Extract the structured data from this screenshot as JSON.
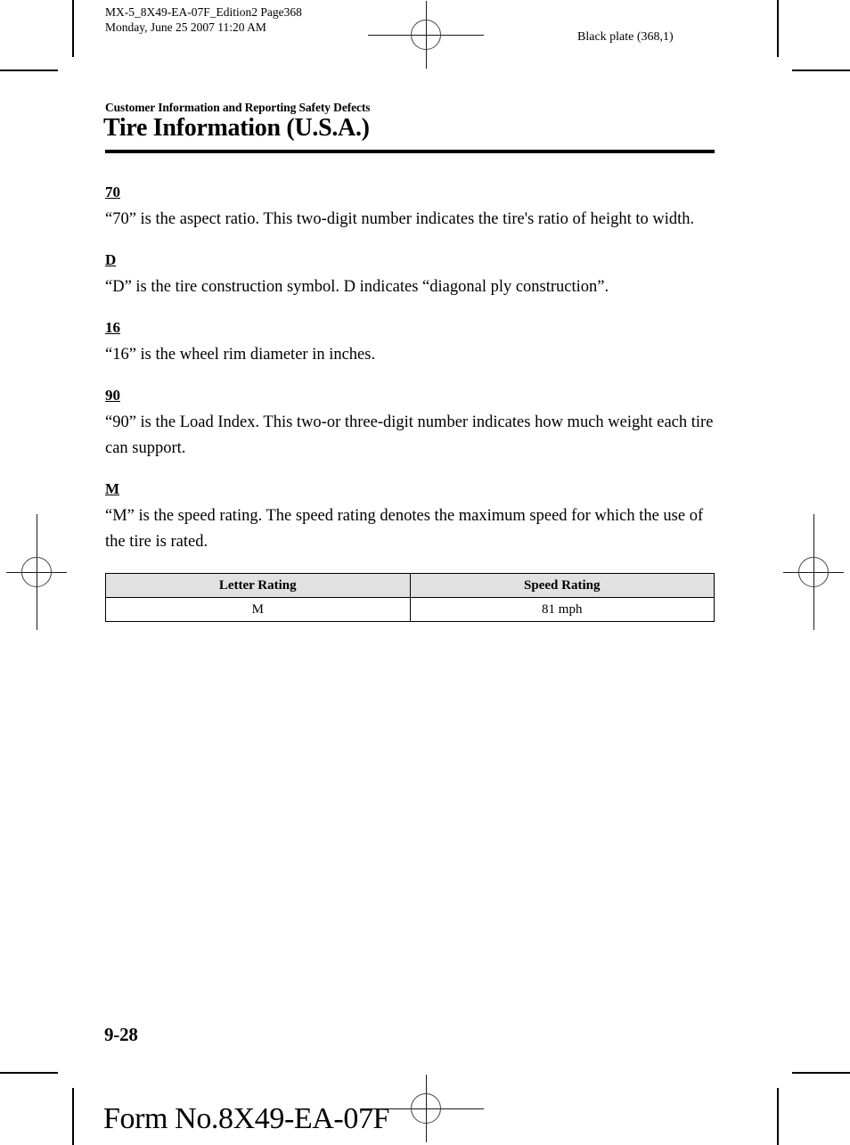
{
  "slug": {
    "line1": "MX-5_8X49-EA-07F_Edition2 Page368",
    "line2": "Monday, June 25 2007 11:20 AM",
    "black_plate": "Black plate (368,1)"
  },
  "header": {
    "kicker": "Customer Information and Reporting Safety Defects",
    "title": "Tire Information (U.S.A.)"
  },
  "sections": [
    {
      "term": "70",
      "body": "“70” is the aspect ratio. This two-digit number indicates the tire's ratio of height to width."
    },
    {
      "term": "D",
      "body": "“D” is the tire construction symbol. D indicates “diagonal ply construction”."
    },
    {
      "term": "16",
      "body": "“16” is the wheel rim diameter in inches."
    },
    {
      "term": "90",
      "body": "“90” is the Load Index. This two-or three-digit number indicates how much weight each tire can support."
    },
    {
      "term": "M",
      "body": "“M” is the speed rating. The speed rating denotes the maximum speed for which the use of the tire is rated."
    }
  ],
  "table": {
    "headers": [
      "Letter Rating",
      "Speed Rating"
    ],
    "rows": [
      [
        "M",
        "81 mph"
      ]
    ]
  },
  "footer": {
    "folio": "9-28",
    "form_number": "Form No.8X49-EA-07F"
  },
  "colors": {
    "table_header_fill": "#e1e1e1",
    "rule": "#000000",
    "text": "#000000"
  }
}
